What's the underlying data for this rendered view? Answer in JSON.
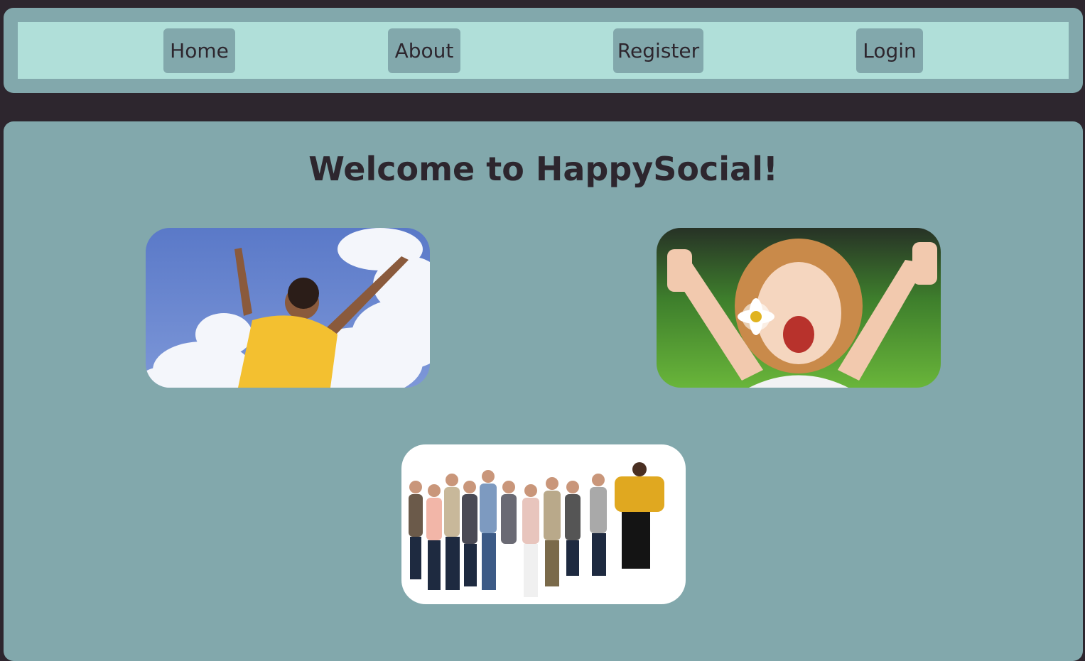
{
  "nav": {
    "home_label": "Home",
    "about_label": "About",
    "register_label": "Register",
    "login_label": "Login"
  },
  "main": {
    "title": "Welcome to HappySocial!"
  },
  "images": [
    {
      "name": "woman-arms-raised-sky-image"
    },
    {
      "name": "girl-thumbs-up-image"
    },
    {
      "name": "group-jumping-image"
    }
  ],
  "colors": {
    "page_background": "#2d262e",
    "panel": "#82a8ac",
    "nav_bar": "#b0dfd9",
    "text": "#2d262e"
  }
}
